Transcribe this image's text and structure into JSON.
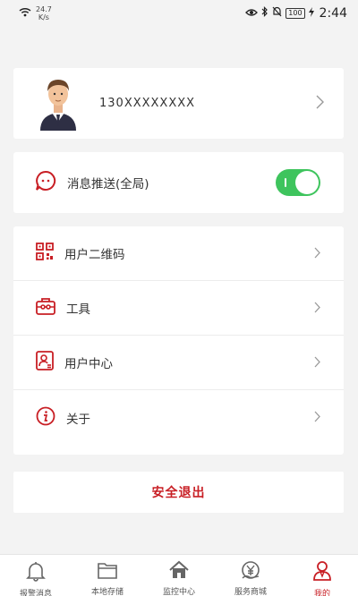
{
  "status_bar": {
    "carrier": "",
    "speed_value": "24.7",
    "speed_unit": "K/s",
    "battery": "100",
    "time": "2:44"
  },
  "profile": {
    "account": "130XXXXXXXX"
  },
  "push": {
    "label": "消息推送(全局)",
    "enabled": true
  },
  "menu": {
    "items": [
      {
        "label": "用户二维码",
        "icon": "qrcode-icon"
      },
      {
        "label": "工具",
        "icon": "toolbox-icon"
      },
      {
        "label": "用户中心",
        "icon": "user-card-icon"
      },
      {
        "label": "关于",
        "icon": "info-icon"
      }
    ]
  },
  "logout_label": "安全退出",
  "tabs": [
    {
      "label": "报警消息",
      "icon": "bell-icon"
    },
    {
      "label": "本地存储",
      "icon": "folder-icon"
    },
    {
      "label": "监控中心",
      "icon": "home-icon"
    },
    {
      "label": "服务商城",
      "icon": "shop-icon"
    },
    {
      "label": "我的",
      "icon": "user-icon",
      "active": true
    }
  ],
  "colors": {
    "accent": "#c81e24",
    "toggle_on": "#3ec45d",
    "background": "#f3f3f3"
  }
}
